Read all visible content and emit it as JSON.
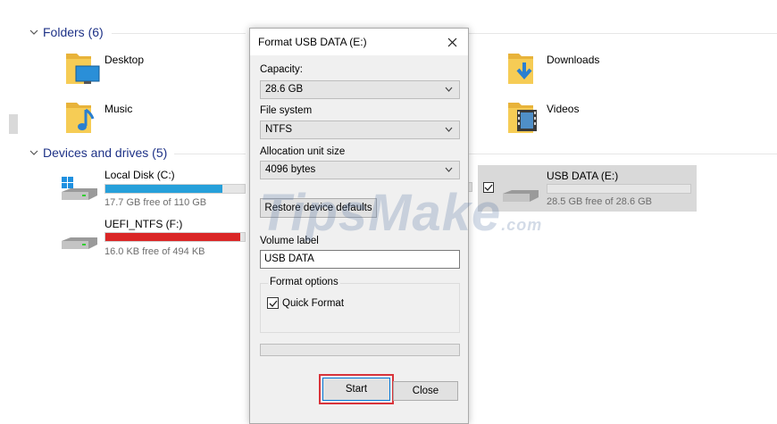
{
  "explorer": {
    "folders_header": "Folders (6)",
    "folders": [
      {
        "name": "Desktop",
        "icon": "desktop-folder-icon"
      },
      {
        "name": "Downloads",
        "icon": "downloads-folder-icon"
      },
      {
        "name": "Music",
        "icon": "music-folder-icon"
      },
      {
        "name": "Videos",
        "icon": "videos-folder-icon"
      }
    ],
    "devices_header": "Devices and drives (5)",
    "drives": [
      {
        "name": "Local Disk (C:)",
        "free": "17.7 GB free of 110 GB",
        "used_fraction": 0.84,
        "bar_color": "#26a0da"
      },
      {
        "name": "UEFI_NTFS (F:)",
        "free": "16.0 KB free of 494 KB",
        "used_fraction": 0.97,
        "bar_color": "#da2626"
      },
      {
        "name": "USB DATA (E:)",
        "free": "28.5 GB free of 28.6 GB",
        "used_fraction": 0.0,
        "bar_color": "#26a0da"
      }
    ]
  },
  "watermark": {
    "main": "TipsMake",
    "suffix": ".com"
  },
  "dialog": {
    "title": "Format USB DATA (E:)",
    "capacity_label": "Capacity:",
    "capacity_value": "28.6 GB",
    "filesystem_label": "File system",
    "filesystem_value": "NTFS",
    "allocation_label": "Allocation unit size",
    "allocation_value": "4096 bytes",
    "restore_button": "Restore device defaults",
    "volume_label": "Volume label",
    "volume_value": "USB DATA",
    "format_options_label": "Format options",
    "quick_format_label": "Quick Format",
    "quick_format_checked": true,
    "progress": 0,
    "start_button": "Start",
    "close_button": "Close"
  }
}
